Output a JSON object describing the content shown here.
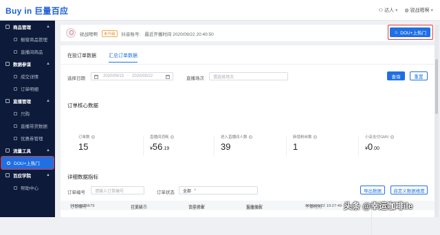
{
  "brand": {
    "logo": "Buy in 巨量百应"
  },
  "topbar": {
    "role": "达人",
    "user": "锐战嗯啊"
  },
  "sidebar": {
    "groups": [
      {
        "label": "商品管理",
        "items": [
          "橱窗商品管理",
          "直播间商品"
        ]
      },
      {
        "label": "数据参谋",
        "items": [
          "成交详情",
          "订单明细"
        ]
      },
      {
        "label": "直播管理",
        "items": [
          "只购",
          "直播带货数据",
          "优惠券管理"
        ]
      },
      {
        "label": "流量工具",
        "items": [
          "DOU+上热门"
        ]
      },
      {
        "label": "百应学院",
        "items": [
          "帮助中心"
        ]
      }
    ],
    "active_item": "DOU+上热门"
  },
  "userbar": {
    "name": "锐战嗯啊",
    "badge": "未升级",
    "account_label": "抖音账号:",
    "last_live": "最近开播时间 2020/09/22 20:40:50",
    "dou_button": "DOU+上热门"
  },
  "tabs": [
    "在投订单数据",
    "汇总订单数据"
  ],
  "filters": {
    "date_label": "选择日期",
    "date_start": "2020/09/15",
    "date_end": "2020/09/22",
    "session_label": "直播场次",
    "session_placeholder": "请选择场次",
    "query": "查询",
    "reset": "重置"
  },
  "core": {
    "title": "订单核心数据",
    "metrics": [
      {
        "label": "订单数",
        "value": "15",
        "currency": "",
        "decimal": ""
      },
      {
        "label": "直播间消耗",
        "value": "56",
        "currency": "¥",
        "decimal": ".19"
      },
      {
        "label": "进入直播间人数",
        "value": "39",
        "currency": "",
        "decimal": ""
      },
      {
        "label": "新增粉丝数",
        "value": "1",
        "currency": "",
        "decimal": ""
      },
      {
        "label": "小店支付GMV",
        "value": "0",
        "currency": "¥",
        "decimal": ".00"
      }
    ]
  },
  "detail": {
    "title": "详细数据指标",
    "order_no_label": "订单编号",
    "order_no_placeholder": "请输入订单编号",
    "order_status_label": "订单状态",
    "order_status_value": "全部",
    "export": "导出数据",
    "custom": "自定义数据维度",
    "columns": [
      "订单编号",
      "订单状态",
      "下单类型",
      "投放类型",
      "下单时间",
      "操作"
    ],
    "rows": [
      {
        "id": "16704526679",
        "status": "已关闭",
        "type": "百应订单",
        "put": "直播加热",
        "time": "2020/09/22 19:27:49"
      }
    ]
  },
  "watermark": "头条 @幸运咖啡ile"
}
